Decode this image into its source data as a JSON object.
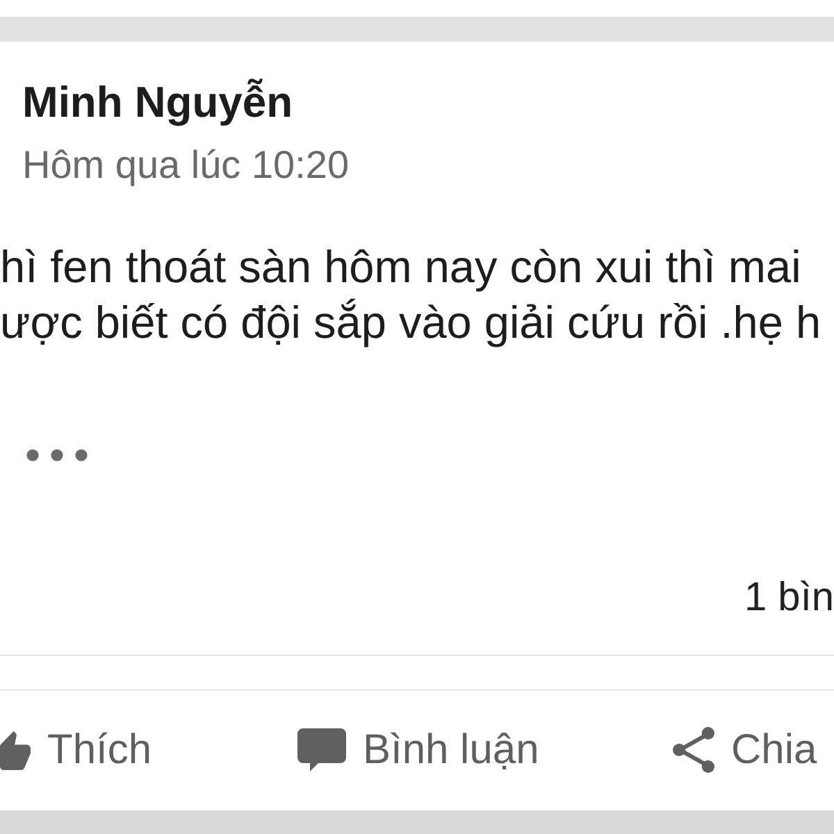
{
  "post": {
    "author": "Minh Nguyễn",
    "time": "Hôm qua lúc 10:20",
    "body_lines": [
      "hì fen thoát sàn hôm nay còn xui thì mai",
      "ược biết có đội sắp vào giải cứu rồi .hẹ h"
    ],
    "comment_count": "1 bìn"
  },
  "actions": [
    {
      "kind": "like",
      "label": "Thích"
    },
    {
      "kind": "comment",
      "label": "Bình luận"
    },
    {
      "kind": "share",
      "label": "Chia"
    }
  ]
}
